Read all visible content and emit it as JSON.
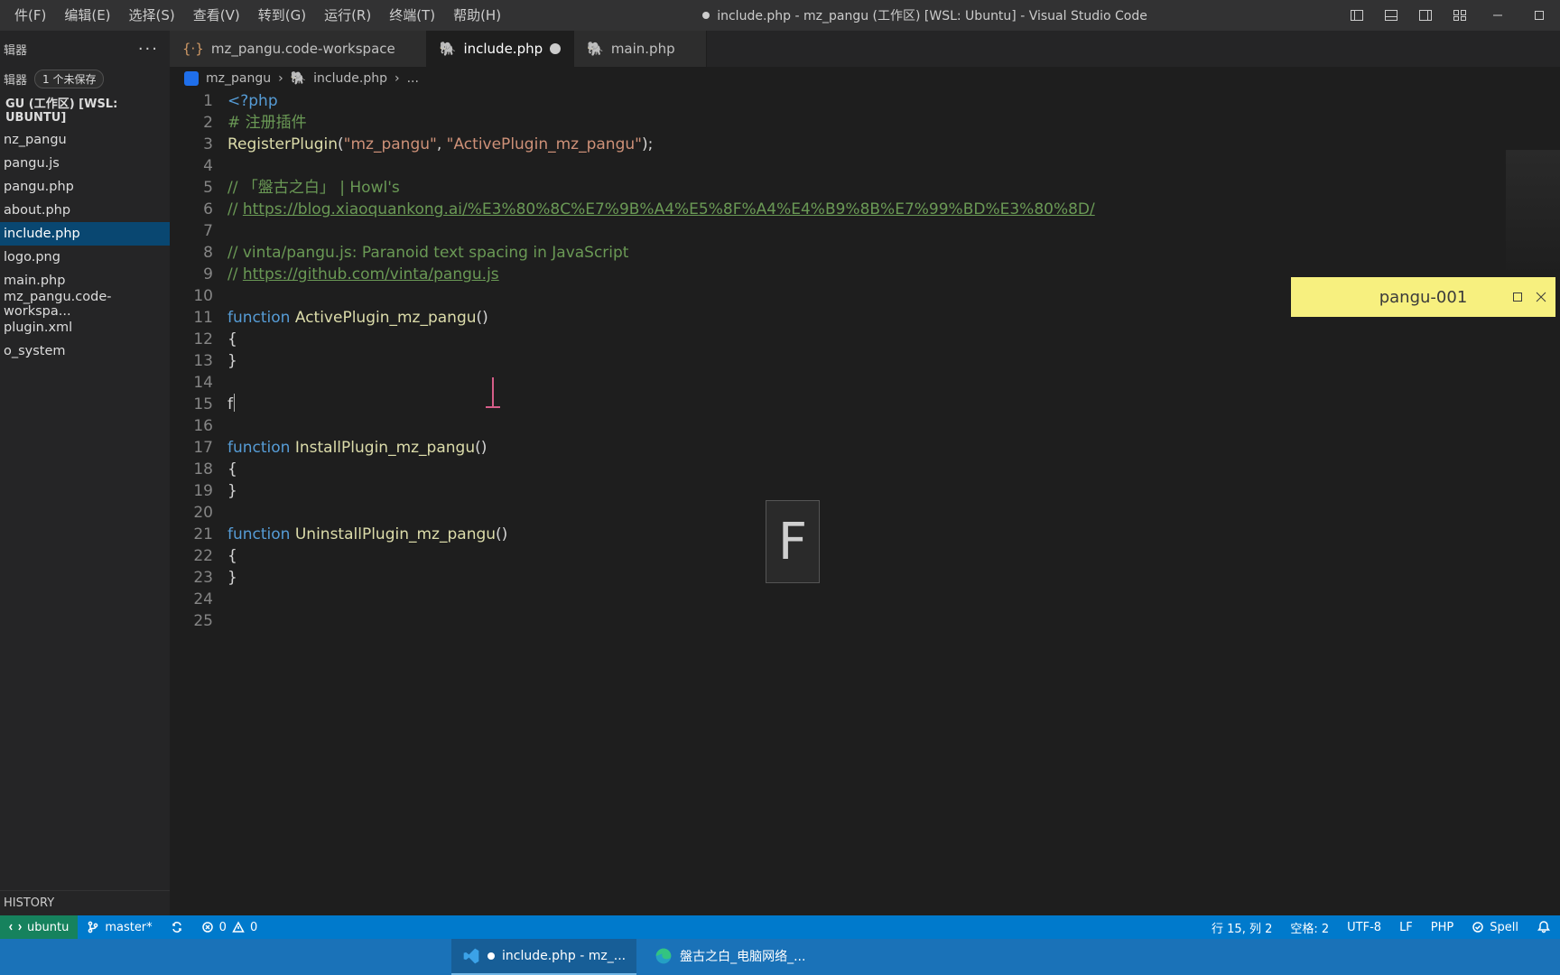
{
  "menu": {
    "file": "件(F)",
    "edit": "编辑(E)",
    "sel": "选择(S)",
    "view": "查看(V)",
    "go": "转到(G)",
    "run": "运行(R)",
    "term": "终端(T)",
    "help": "帮助(H)"
  },
  "window_title": "include.php - mz_pangu (工作区) [WSL: Ubuntu] - Visual Studio Code",
  "explorer": {
    "group_label": "辑器",
    "unsaved_badge": "1 个未保存",
    "workspace_label": "GU (工作区) [WSL: UBUNTU]",
    "files": [
      "nz_pangu",
      "pangu.js",
      "pangu.php",
      "about.php",
      "include.php",
      "logo.png",
      "main.php",
      "mz_pangu.code-workspa...",
      "plugin.xml",
      "o_system"
    ],
    "selected": "include.php",
    "history": "HISTORY"
  },
  "tabs": [
    {
      "label": "mz_pangu.code-workspace",
      "kind": "workspace"
    },
    {
      "label": "include.php",
      "kind": "php",
      "state": "modified",
      "active": true
    },
    {
      "label": "main.php",
      "kind": "php"
    }
  ],
  "breadcrumbs": [
    "mz_pangu",
    "include.php",
    "..."
  ],
  "code_lines": [
    {
      "n": 1,
      "html": "<span class='tk-tag'>&lt;?php</span>"
    },
    {
      "n": 2,
      "html": "<span class='tk-cmt'># 注册插件</span>"
    },
    {
      "n": 3,
      "html": "<span class='tk-fn'>RegisterPlugin</span>(<span class='tk-str'>\"mz_pangu\"</span>, <span class='tk-str'>\"ActivePlugin_mz_pangu\"</span>);"
    },
    {
      "n": 4,
      "html": ""
    },
    {
      "n": 5,
      "html": "<span class='tk-cmt'>// 「盤古之白」 | Howl's</span>"
    },
    {
      "n": 6,
      "html": "<span class='tk-cmt'>// </span><span class='tk-url'>https://blog.xiaoquankong.ai/%E3%80%8C%E7%9B%A4%E5%8F%A4%E4%B9%8B%E7%99%BD%E3%80%8D/</span>"
    },
    {
      "n": 7,
      "html": ""
    },
    {
      "n": 8,
      "html": "<span class='tk-cmt'>// vinta/pangu.js: Paranoid text spacing in JavaScript</span>"
    },
    {
      "n": 9,
      "html": "<span class='tk-cmt'>// </span><span class='tk-url'>https://github.com/vinta/pangu.js</span>"
    },
    {
      "n": 10,
      "html": ""
    },
    {
      "n": 11,
      "html": "<span class='tk-kw'>function</span> <span class='tk-fn'>ActivePlugin_mz_pangu</span>()"
    },
    {
      "n": 12,
      "html": "{"
    },
    {
      "n": 13,
      "html": "}"
    },
    {
      "n": 14,
      "html": ""
    },
    {
      "n": 15,
      "html": "f<span class='cursor'></span>"
    },
    {
      "n": 16,
      "html": ""
    },
    {
      "n": 17,
      "html": "<span class='tk-kw'>function</span> <span class='tk-fn'>InstallPlugin_mz_pangu</span>()"
    },
    {
      "n": 18,
      "html": "{"
    },
    {
      "n": 19,
      "html": "}"
    },
    {
      "n": 20,
      "html": ""
    },
    {
      "n": 21,
      "html": "<span class='tk-kw'>function</span> <span class='tk-fn'>UninstallPlugin_mz_pangu</span>()"
    },
    {
      "n": 22,
      "html": "{"
    },
    {
      "n": 23,
      "html": "}"
    },
    {
      "n": 24,
      "html": ""
    },
    {
      "n": 25,
      "html": ""
    }
  ],
  "big_key": "F",
  "sticky": "pangu-001",
  "status": {
    "remote": "ubuntu",
    "branch": "master*",
    "errors": "0",
    "warnings": "0",
    "pos": "行 15, 列 2",
    "spaces": "空格: 2",
    "enc": "UTF-8",
    "eol": "LF",
    "lang": "PHP",
    "spell": "Spell"
  },
  "taskbar": [
    {
      "label": "include.php - mz_...",
      "app": "vscode",
      "active": true
    },
    {
      "label": "盤古之白_电脑网络_...",
      "app": "edge"
    }
  ]
}
